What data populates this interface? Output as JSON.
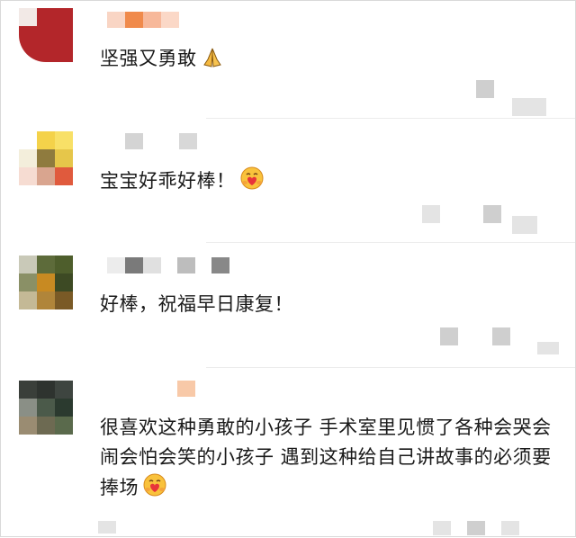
{
  "comments": [
    {
      "text": "坚强又勇敢",
      "emoji": "pray-icon"
    },
    {
      "text": "宝宝好乖好棒！",
      "emoji": "heart-hug-face-icon"
    },
    {
      "text": "好棒，祝福早日康复！",
      "emoji": ""
    },
    {
      "text": "很喜欢这种勇敢的小孩子 手术室里见惯了各种会哭会闹会怕会笑的小孩子 遇到这种给自己讲故事的必须要捧场",
      "emoji": "heart-hug-face-icon"
    }
  ],
  "colors": {
    "text": "#1a1a1a",
    "divider": "#ececec",
    "blur": "#cfcfcf"
  }
}
